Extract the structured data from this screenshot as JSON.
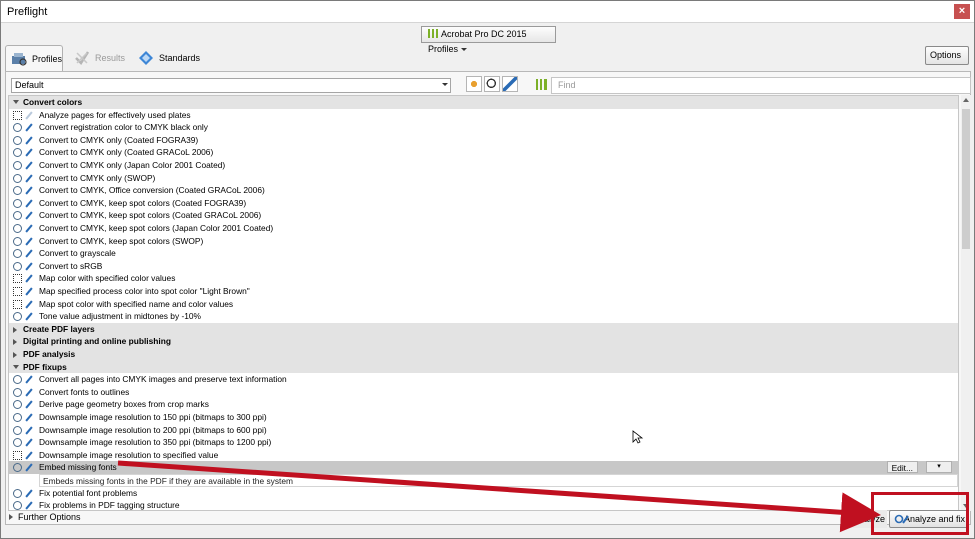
{
  "window": {
    "title": "Preflight"
  },
  "profile_dropdown": {
    "label": "Acrobat Pro DC 2015 Profiles"
  },
  "tabs": [
    {
      "label": "Profiles",
      "state": "active"
    },
    {
      "label": "Results",
      "state": "disabled"
    },
    {
      "label": "Standards",
      "state": "normal"
    }
  ],
  "options_button": {
    "label": "Options"
  },
  "filter": {
    "selected": "Default"
  },
  "find": {
    "placeholder": "Find"
  },
  "list": {
    "rows": [
      {
        "type": "group",
        "expanded": true,
        "label": "Convert colors"
      },
      {
        "type": "item",
        "icon": "grid",
        "faded": true,
        "label": "Analyze pages for effectively used plates"
      },
      {
        "type": "item",
        "icon": "mag",
        "label": "Convert registration color to CMYK black only"
      },
      {
        "type": "item",
        "icon": "mag",
        "label": "Convert to CMYK only (Coated FOGRA39)"
      },
      {
        "type": "item",
        "icon": "mag",
        "label": "Convert to CMYK only (Coated GRACoL 2006)"
      },
      {
        "type": "item",
        "icon": "mag",
        "label": "Convert to CMYK only (Japan Color 2001 Coated)"
      },
      {
        "type": "item",
        "icon": "mag",
        "label": "Convert to CMYK only (SWOP)"
      },
      {
        "type": "item",
        "icon": "mag",
        "label": "Convert to CMYK, Office conversion (Coated GRACoL 2006)"
      },
      {
        "type": "item",
        "icon": "mag",
        "label": "Convert to CMYK, keep spot colors (Coated FOGRA39)"
      },
      {
        "type": "item",
        "icon": "mag",
        "label": "Convert to CMYK, keep spot colors (Coated GRACoL 2006)"
      },
      {
        "type": "item",
        "icon": "mag",
        "label": "Convert to CMYK, keep spot colors (Japan Color 2001 Coated)"
      },
      {
        "type": "item",
        "icon": "mag",
        "label": "Convert to CMYK, keep spot colors (SWOP)"
      },
      {
        "type": "item",
        "icon": "mag",
        "label": "Convert to grayscale"
      },
      {
        "type": "item",
        "icon": "mag",
        "label": "Convert to sRGB"
      },
      {
        "type": "item",
        "icon": "grid",
        "label": "Map color with specified color values"
      },
      {
        "type": "item",
        "icon": "grid",
        "label": "Map specified process color into spot color \"Light Brown\""
      },
      {
        "type": "item",
        "icon": "grid",
        "label": "Map spot color with specified name and color values"
      },
      {
        "type": "item",
        "icon": "mag",
        "label": "Tone value adjustment in midtones by -10%"
      },
      {
        "type": "group",
        "expanded": false,
        "label": "Create PDF layers"
      },
      {
        "type": "group",
        "expanded": false,
        "label": "Digital printing and online publishing"
      },
      {
        "type": "group",
        "expanded": false,
        "label": "PDF analysis"
      },
      {
        "type": "group",
        "expanded": true,
        "label": "PDF fixups"
      },
      {
        "type": "item",
        "icon": "mag",
        "label": "Convert all pages into CMYK images and preserve text information"
      },
      {
        "type": "item",
        "icon": "mag",
        "label": "Convert fonts to outlines"
      },
      {
        "type": "item",
        "icon": "mag",
        "label": "Derive page geometry boxes from crop marks"
      },
      {
        "type": "item",
        "icon": "mag",
        "label": "Downsample image resolution to 150 ppi (bitmaps to 300 ppi)"
      },
      {
        "type": "item",
        "icon": "mag",
        "label": "Downsample image resolution to 200 ppi (bitmaps to 600 ppi)"
      },
      {
        "type": "item",
        "icon": "mag",
        "label": "Downsample image resolution to 350 ppi (bitmaps to 1200 ppi)"
      },
      {
        "type": "item",
        "icon": "grid",
        "label": "Downsample image resolution to specified value"
      },
      {
        "type": "item",
        "icon": "mag",
        "selected": true,
        "label": "Embed missing fonts"
      },
      {
        "type": "desc",
        "label": "Embeds missing fonts in the PDF if they are available in the system"
      },
      {
        "type": "item",
        "icon": "mag",
        "label": "Fix potential font problems"
      },
      {
        "type": "item",
        "icon": "mag",
        "label": "Fix problems in PDF tagging structure"
      }
    ],
    "edit_label": "Edit...",
    "flag_label": "▾"
  },
  "further_options": {
    "label": "Further Options"
  },
  "buttons": {
    "analyze": "Analyze",
    "analyze_and_fix": "Analyze and fix"
  },
  "colors": {
    "callout": "#c01020",
    "accent_green": "#7cb028",
    "wrench_blue": "#2a6bb5"
  }
}
